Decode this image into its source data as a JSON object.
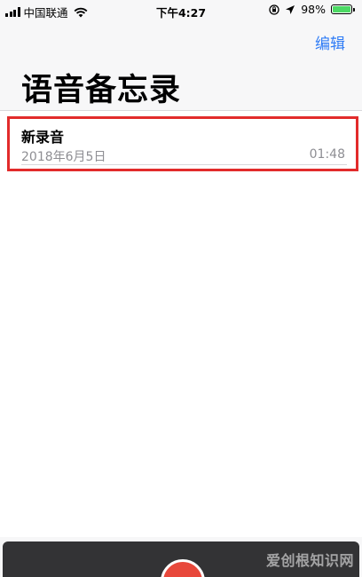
{
  "status_bar": {
    "carrier": "中国联通",
    "time": "下午4:27",
    "battery_percent_label": "98%",
    "battery_level": 0.98,
    "battery_color": "#4cd964"
  },
  "nav": {
    "edit_label": "编辑"
  },
  "page": {
    "title": "语音备忘录"
  },
  "recordings": [
    {
      "title": "新录音",
      "date": "2018年6月5日",
      "duration": "01:48"
    }
  ],
  "watermark": "爱创根知识网",
  "colors": {
    "accent": "#2f7cf6",
    "highlight_border": "#e22b2b",
    "record_button": "#e8483b"
  }
}
